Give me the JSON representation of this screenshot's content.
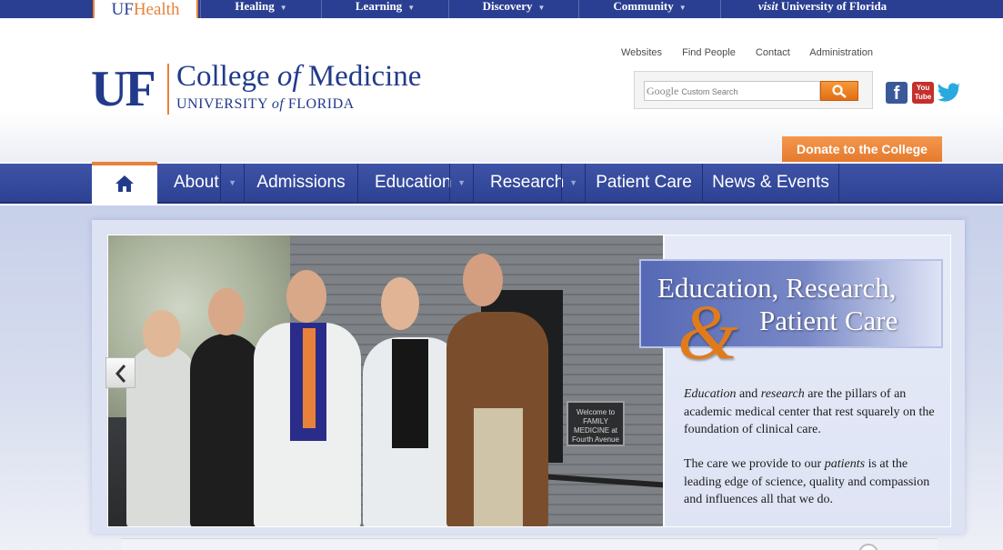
{
  "topbar": {
    "ufhealth_uf": "UF",
    "ufhealth_health": "Health",
    "items": [
      {
        "label": "Healing"
      },
      {
        "label": "Learning"
      },
      {
        "label": "Discovery"
      },
      {
        "label": "Community"
      }
    ],
    "visit_prefix": "visit",
    "visit_label": "University of Florida"
  },
  "header": {
    "logo_mark": "UF",
    "title_a": "College ",
    "title_of": "of",
    "title_b": " Medicine",
    "sub_a": "UNIVERSITY ",
    "sub_of": "of",
    "sub_b": " FLORIDA",
    "links": [
      "Websites",
      "Find People",
      "Contact",
      "Administration"
    ],
    "search": {
      "brand": "Google",
      "placeholder": "Custom Search"
    },
    "donate_label": "Donate to the College"
  },
  "social": {
    "facebook": "f",
    "youtube_a": "You",
    "youtube_b": "Tube"
  },
  "nav": {
    "items": [
      {
        "label": "About"
      },
      {
        "label": "Admissions"
      },
      {
        "label": "Education"
      },
      {
        "label": "Research"
      },
      {
        "label": "Patient Care"
      },
      {
        "label": "News & Events"
      }
    ]
  },
  "hero": {
    "sign_text": "Welcome to FAMILY MEDICINE at Fourth Avenue",
    "tagline_line1": "Education, Research,",
    "tagline_amp": "&",
    "tagline_line2": "Patient Care",
    "p1_a": "Education",
    "p1_b": " and ",
    "p1_c": "research",
    "p1_d": " are the pillars of an academic medical center that rest squarely on the foundation of clinical care.",
    "p2_a": "The care we provide to our ",
    "p2_b": "patients",
    "p2_c": " is at the leading edge of science, quality and compassion and influences all that we do."
  },
  "colors": {
    "primary_blue": "#2b3f92",
    "accent_orange": "#e8823a"
  }
}
